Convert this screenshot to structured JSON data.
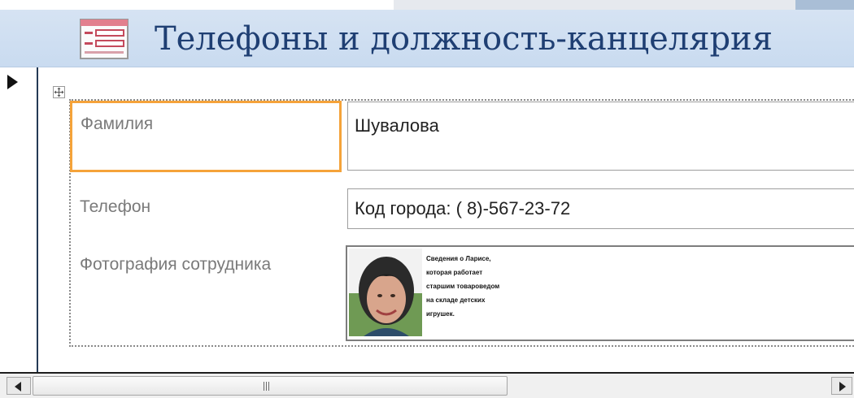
{
  "form": {
    "title": "Телефоны и должность-канцелярия"
  },
  "fields": {
    "surname_label": "Фамилия",
    "surname_value": "Шувалова",
    "phone_label": "Телефон",
    "phone_value": "Код города: ( 8)-567-23-72",
    "photo_label": "Фотография сотрудника"
  },
  "photo": {
    "caption_lines": [
      "Сведения о Ларисе,",
      "которая работает",
      "старшим товароведом",
      "на складе детских",
      "игрушек."
    ]
  },
  "scrollbar": {
    "grip": "III"
  },
  "colors": {
    "header_bg": "#c9dbf0",
    "title_text": "#1f3f73",
    "selected_label_border": "#f5a33a"
  }
}
